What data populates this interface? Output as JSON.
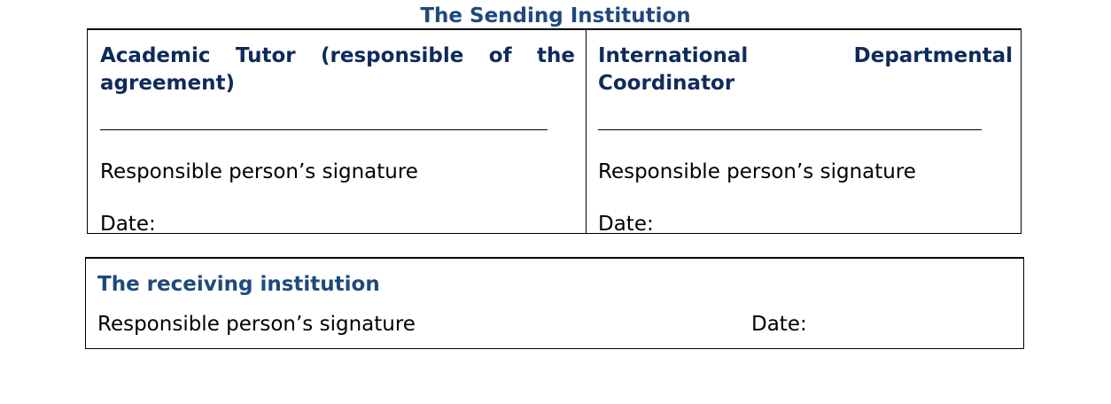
{
  "sending_institution": {
    "title": "The Sending Institution",
    "left_column": {
      "heading": "Academic Tutor (responsible of the agreement)",
      "signature_label": "Responsible person’s signature",
      "date_label": "Date:"
    },
    "right_column": {
      "heading": "International Departmental Coordinator",
      "signature_label": "Responsible person’s signature",
      "date_label": "Date:"
    }
  },
  "receiving_institution": {
    "title": "The receiving institution",
    "signature_label": "Responsible person’s signature",
    "date_label": "Date:"
  },
  "colors": {
    "title_blue": "#1F497D",
    "heading_navy": "#0F2A5C"
  }
}
